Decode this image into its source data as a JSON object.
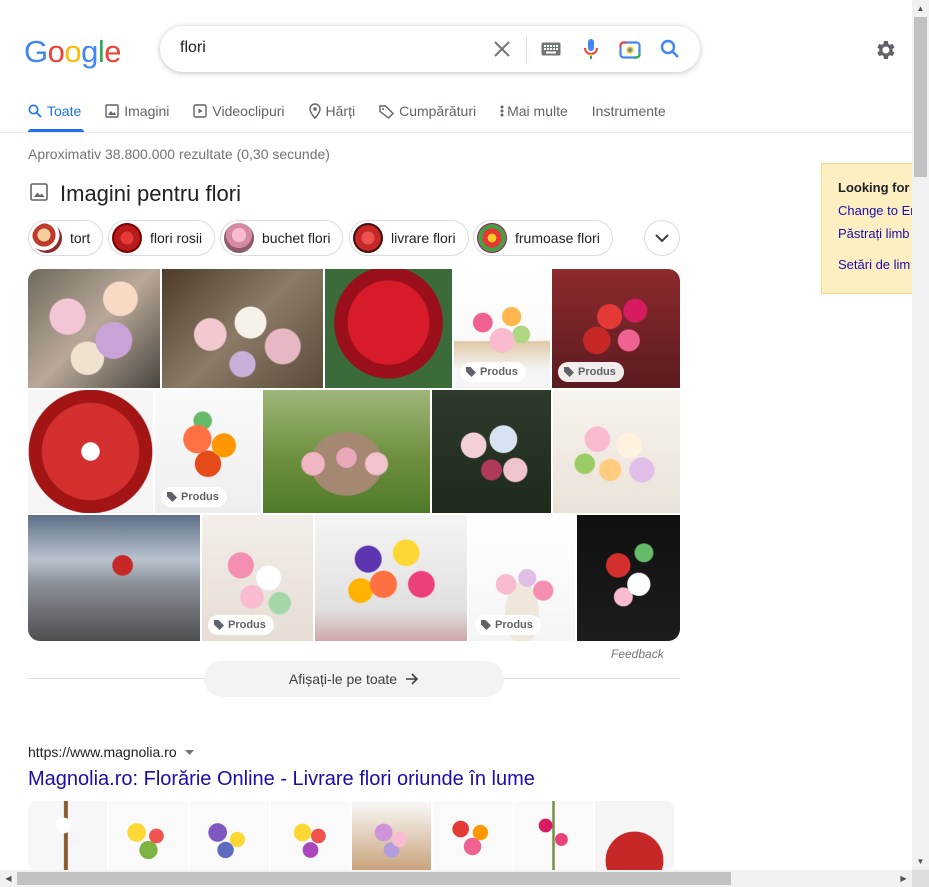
{
  "search": {
    "query": "flori"
  },
  "tabs": [
    {
      "label": "Toate",
      "icon": "search-icon"
    },
    {
      "label": "Imagini",
      "icon": "image-icon"
    },
    {
      "label": "Videoclipuri",
      "icon": "video-icon"
    },
    {
      "label": "Hărți",
      "icon": "pin-icon"
    },
    {
      "label": "Cumpărături",
      "icon": "tag-icon"
    },
    {
      "label": "Mai multe",
      "icon": "more-vert-icon"
    },
    {
      "label": "Instrumente",
      "icon": ""
    }
  ],
  "stats": "Aproximativ 38.800.000 rezultate (0,30 secunde)",
  "images": {
    "title": "Imagini pentru flori",
    "chips": [
      "tort",
      "flori rosii",
      "buchet flori",
      "livrare flori",
      "frumoase flori"
    ],
    "badge_label": "Produs",
    "feedback": "Feedback",
    "show_all": "Afișați-le pe toate"
  },
  "popup": {
    "title": "Looking for",
    "links": [
      "Change to Er",
      "Păstrați limb",
      "Setări de lim"
    ]
  },
  "result": {
    "url": "https://www.magnolia.ro",
    "title": "Magnolia.ro: Florărie Online - Livrare flori oriunde în lume"
  },
  "colors": {
    "accent": "#1a73e8",
    "link": "#1a0dab",
    "popup_bg": "#feefc3"
  }
}
